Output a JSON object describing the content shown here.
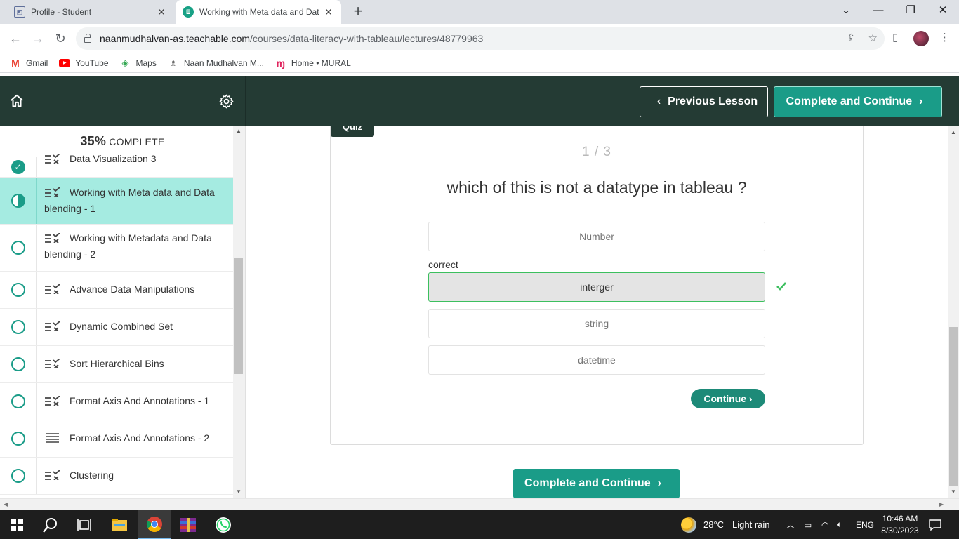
{
  "browser": {
    "tabs": [
      {
        "title": "Profile - Student",
        "active": false
      },
      {
        "title": "Working with Meta data and Dat",
        "active": true
      }
    ],
    "url_host": "naanmudhalvan-as.teachable.com",
    "url_path": "/courses/data-literacy-with-tableau/lectures/48779963",
    "bookmarks": [
      {
        "label": "Gmail",
        "icon": "gmail-icon"
      },
      {
        "label": "YouTube",
        "icon": "youtube-icon"
      },
      {
        "label": "Maps",
        "icon": "maps-icon"
      },
      {
        "label": "Naan Mudhalvan M...",
        "icon": "naan-mudhalvan-icon"
      },
      {
        "label": "Home • MURAL",
        "icon": "mural-icon"
      }
    ]
  },
  "header": {
    "prev_label": "Previous Lesson",
    "next_label": "Complete and Continue"
  },
  "sidebar": {
    "progress_pct": "35%",
    "progress_word": "COMPLETE",
    "lessons": [
      {
        "title": "Data Visualization 3",
        "status": "complete",
        "type": "quiz"
      },
      {
        "title": "Working with Meta data and Data blending - 1",
        "status": "in-progress",
        "type": "quiz"
      },
      {
        "title": "Working with Metadata and Data blending - 2",
        "status": "not-started",
        "type": "quiz"
      },
      {
        "title": "Advance Data Manipulations",
        "status": "not-started",
        "type": "quiz"
      },
      {
        "title": "Dynamic Combined Set",
        "status": "not-started",
        "type": "quiz"
      },
      {
        "title": "Sort Hierarchical Bins",
        "status": "not-started",
        "type": "quiz"
      },
      {
        "title": "Format Axis And Annotations - 1",
        "status": "not-started",
        "type": "quiz"
      },
      {
        "title": "Format Axis And Annotations - 2",
        "status": "not-started",
        "type": "text"
      },
      {
        "title": "Clustering",
        "status": "not-started",
        "type": "quiz"
      }
    ]
  },
  "quiz": {
    "tag": "Quiz",
    "counter": "1 / 3",
    "question": "which of this is not a datatype in tableau ?",
    "correct_label": "correct",
    "answers": [
      "Number",
      "interger",
      "string",
      "datetime"
    ],
    "selected_index": 1,
    "continue_label": "Continue ›"
  },
  "footer": {
    "next_label": "Complete and Continue"
  },
  "taskbar": {
    "weather_temp": "28°C",
    "weather_desc": "Light rain",
    "language": "ENG",
    "time": "10:46 AM",
    "date": "8/30/2023"
  },
  "colors": {
    "header_bg": "#243b34",
    "accent": "#1a9c88",
    "current_lesson_bg": "#a5ebe1"
  }
}
